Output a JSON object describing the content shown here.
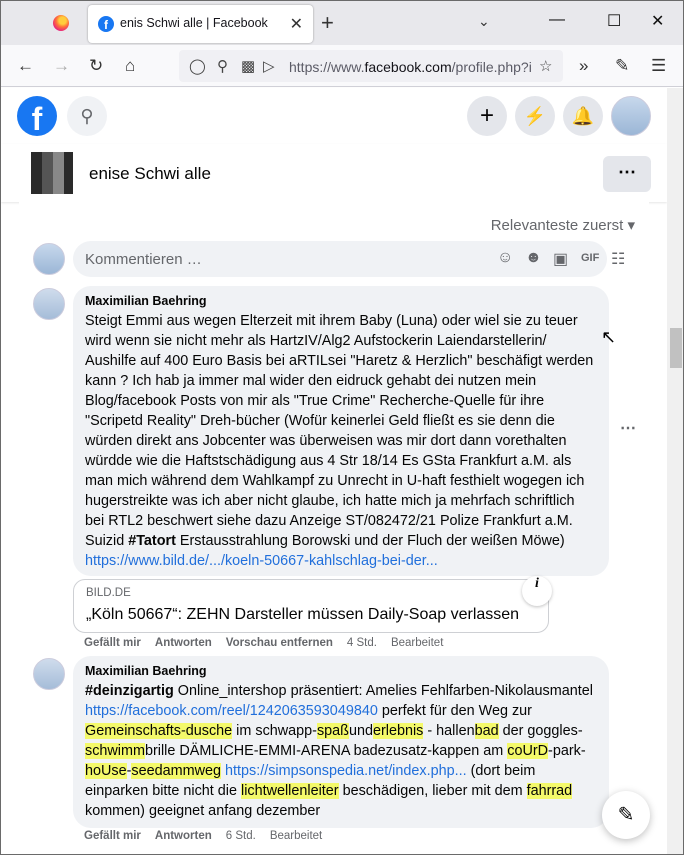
{
  "browser": {
    "tab_title": "enis Schwi alle | Facebook",
    "url_prefix": "https://www.",
    "url_domain": "facebook.com",
    "url_rest": "/profile.php?i",
    "new_tab": "+",
    "tab_close": "✕"
  },
  "facebook": {
    "logo": "f",
    "profile_name": "enise Schwi alle"
  },
  "comments_section": {
    "sort_label": "Relevanteste zuerst",
    "comment_placeholder": "Kommentieren …"
  },
  "comments": [
    {
      "author": "Maximilian Baehring",
      "text": "Steigt Emmi aus wegen Elterzeit mit ihrem Baby (Luna) oder wiel sie zu teuer wird wenn sie nicht mehr als HartzIV/Alg2 Aufstockerin Laiendarstellerin/ Aushilfe auf 400 Euro Basis bei aRTILsei \"Haretz & Herzlich\" beschäfigt werden kann ? Ich hab ja immer mal wider den eidruck gehabt dei nutzen mein Blog/facebook Posts von mir als \"True Crime\" Recherche-Quelle für ihre \"Scripetd Reality\" Dreh-bücher (Wofür keinerlei Geld fließt es sie denn die würden direkt ans Jobcenter was überweisen was mir dort dann vorethalten würdde wie die Haftstschädigung aus 4 Str 18/14 Es GSta Frankfurt a.M. als man mich während dem Wahlkampf zu Unrecht in U-haft festhielt wogegen ich hugerstreikte was ich aber nicht glaube, ich hatte mich ja mehrfach schriftlich bei RTL2 beschwert siehe dazu Anzeige ST/082472/21 Polize Frankfurt a.M. Suizid ",
      "tag": "#Tatort",
      "text_after": " Erstausstrahlung Borowski und der Fluch der weißen Möwe) ",
      "link": "https://www.bild.de/.../koeln-50667-kahlschlag-bei-der...",
      "preview_site": "BILD.DE",
      "preview_title": "„Köln 50667“: ZEHN Darsteller müssen Daily-Soap verlassen",
      "actions": {
        "like": "Gefällt mir",
        "reply": "Antworten",
        "remove_preview": "Vorschau entfernen",
        "time": "4 Std.",
        "edited": "Bearbeitet"
      }
    },
    {
      "author": "Maximilian Baehring",
      "hashtag": "#deinzigartig",
      "t1": " Online_intershop präsentiert: Amelies Fehlfarben-Nikolausmantel ",
      "link1": "https://facebook.com/reel/1242063593049840",
      "t2": " perfekt für den Weg zur ",
      "h1": "Gemeinschafts-dusche",
      "t3": " im schwapp-",
      "h2": "spaß",
      "t4": "und",
      "h3": "erlebnis",
      "t5": " - hallen",
      "h4": "bad",
      "t6": " der goggles-",
      "h5": "schwimm",
      "t7": "brille DÄMLICHE-EMMI-ARENA badezusatz-kappen am ",
      "h6": "coUrD",
      "t8": "-park-",
      "h7": "hoUse",
      "t9": "-",
      "h8": "seedammweg",
      "t10": " ",
      "link2": "https://simpsonspedia.net/index.php...",
      "t11": " (dort beim einparken bitte nicht die ",
      "h9": "lichtwellenleiter",
      "t12": " beschädigen, lieber mit dem ",
      "h10": "fahrrad",
      "t13": " kommen) geeignet anfang dezember",
      "actions": {
        "like": "Gefällt mir",
        "reply": "Antworten",
        "time": "6 Std.",
        "edited": "Bearbeitet"
      }
    }
  ]
}
